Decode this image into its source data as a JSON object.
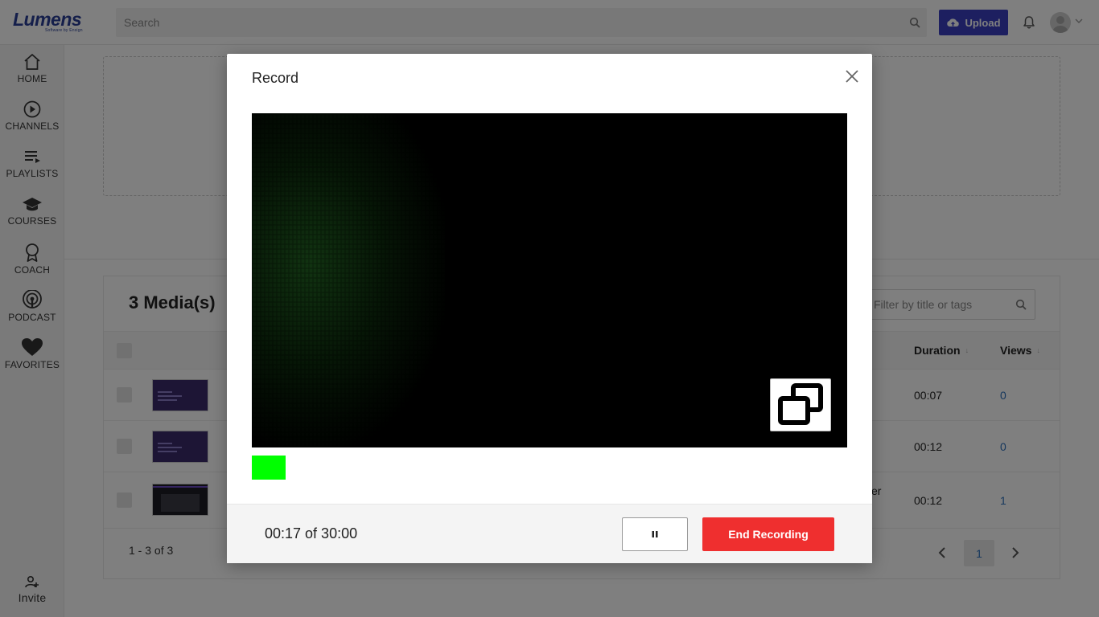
{
  "header": {
    "logo_text": "Lumens",
    "logo_tagline": "Software by Ensign",
    "search_placeholder": "Search",
    "upload_label": "Upload",
    "icons": [
      "search-icon",
      "cloud-upload-icon",
      "bell-icon",
      "avatar",
      "chevron-down-icon"
    ]
  },
  "sidebar": {
    "items": [
      {
        "label": "HOME",
        "icon": "home-icon"
      },
      {
        "label": "CHANNELS",
        "icon": "play-circle-icon"
      },
      {
        "label": "PLAYLISTS",
        "icon": "playlist-icon"
      },
      {
        "label": "COURSES",
        "icon": "graduation-cap-icon"
      },
      {
        "label": "COACH",
        "icon": "award-icon"
      },
      {
        "label": "PODCAST",
        "icon": "podcast-icon"
      },
      {
        "label": "FAVORITES",
        "icon": "heart-icon"
      }
    ],
    "invite_label": "Invite"
  },
  "media": {
    "title": "3 Media(s)",
    "filter_placeholder": "Filter by title or tags",
    "columns": {
      "duration": "Duration",
      "views": "Views"
    },
    "rows": [
      {
        "title_fragment": "",
        "duration": "00:07",
        "views": "0"
      },
      {
        "title_fragment": "",
        "duration": "00:12",
        "views": "0"
      },
      {
        "title_fragment": "er",
        "duration": "00:12",
        "views": "1"
      }
    ],
    "pager_info": "1 - 3 of 3",
    "current_page": "1"
  },
  "modal": {
    "title": "Record",
    "close_icon": "close-icon",
    "pip_icon": "picture-in-picture-icon",
    "audio_level_color": "#00ff00",
    "timer": "00:17 of 30:00",
    "pause_icon": "pause-icon",
    "end_label": "End Recording",
    "end_color": "#ef2f2f"
  },
  "colors": {
    "brand": "#2a3f96",
    "upload_button": "#3b3fc0",
    "link": "#2a6ebb"
  }
}
